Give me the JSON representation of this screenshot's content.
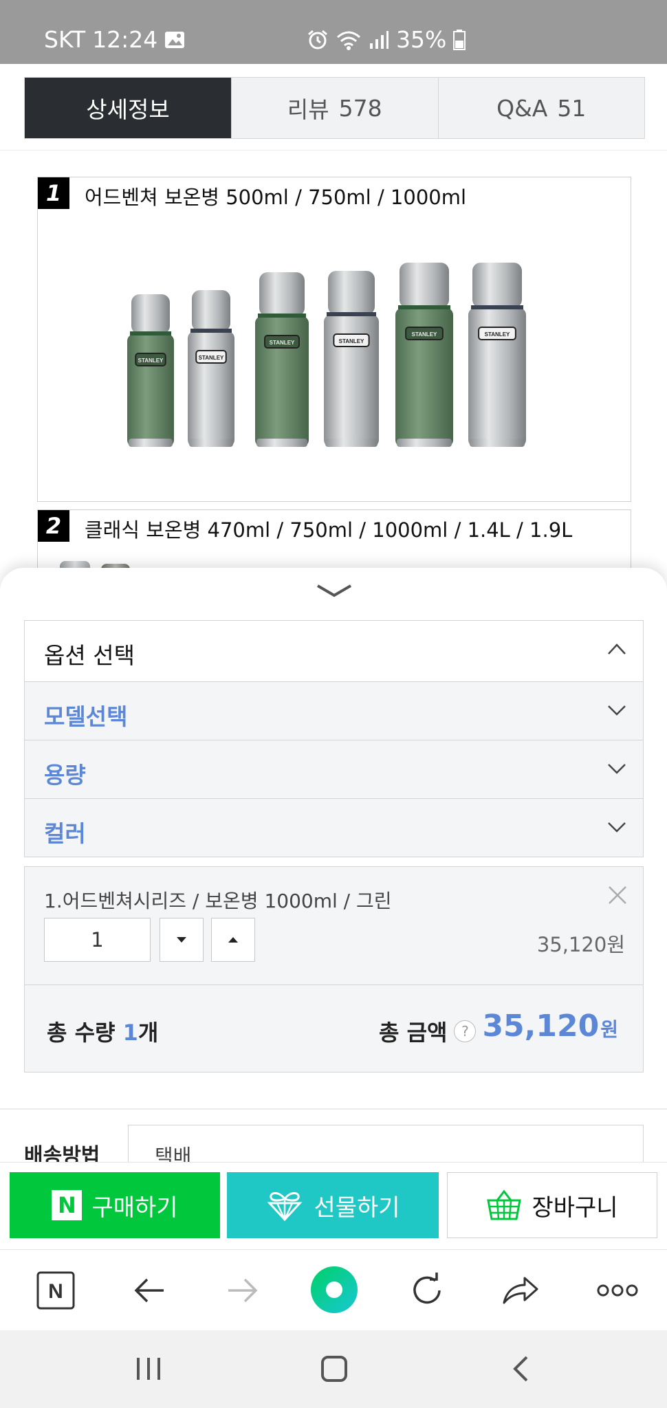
{
  "status_bar": {
    "carrier": "SKT",
    "time": "12:24",
    "battery": "35%"
  },
  "tabs": [
    {
      "label": "상세정보",
      "count": ""
    },
    {
      "label": "리뷰",
      "count": "578"
    },
    {
      "label": "Q&A",
      "count": "51"
    }
  ],
  "detail": {
    "section1": {
      "number": "1",
      "title": "어드벤쳐 보온병 500ml /  750ml / 1000ml"
    },
    "section2": {
      "number": "2",
      "title": "클래식 보온병 470ml / 750ml / 1000ml / 1.4L / 1.9L"
    },
    "brand": "STANLEY",
    "bottle_colors": [
      "#6f8f70",
      "#b9bcbe",
      "#6f8f70",
      "#b9bcbe",
      "#6f8f70",
      "#b9bcbe"
    ]
  },
  "options": {
    "header": "옵션 선택",
    "rows": [
      "모델선택",
      "용량",
      "컬러"
    ]
  },
  "selected_item": {
    "name": "1.어드벤쳐시리즈 / 보온병 1000ml / 그린",
    "quantity": "1",
    "price": "35,120원"
  },
  "totals": {
    "qty_label": "총 수량",
    "qty_value": "1",
    "qty_unit": "개",
    "amount_label": "총 금액",
    "help": "?",
    "amount": "35,120",
    "amount_unit": "원"
  },
  "shipping": {
    "label": "배송방법",
    "value": "택배"
  },
  "buttons": {
    "buy": "구매하기",
    "buy_logo": "N",
    "gift": "선물하기",
    "cart": "장바구니"
  },
  "browser": {
    "home_logo": "N"
  },
  "colors": {
    "accent_blue": "#5b87d6",
    "naver_green": "#00c73c",
    "gift_teal": "#1fc8c4",
    "active_tab": "#2a2d31"
  }
}
